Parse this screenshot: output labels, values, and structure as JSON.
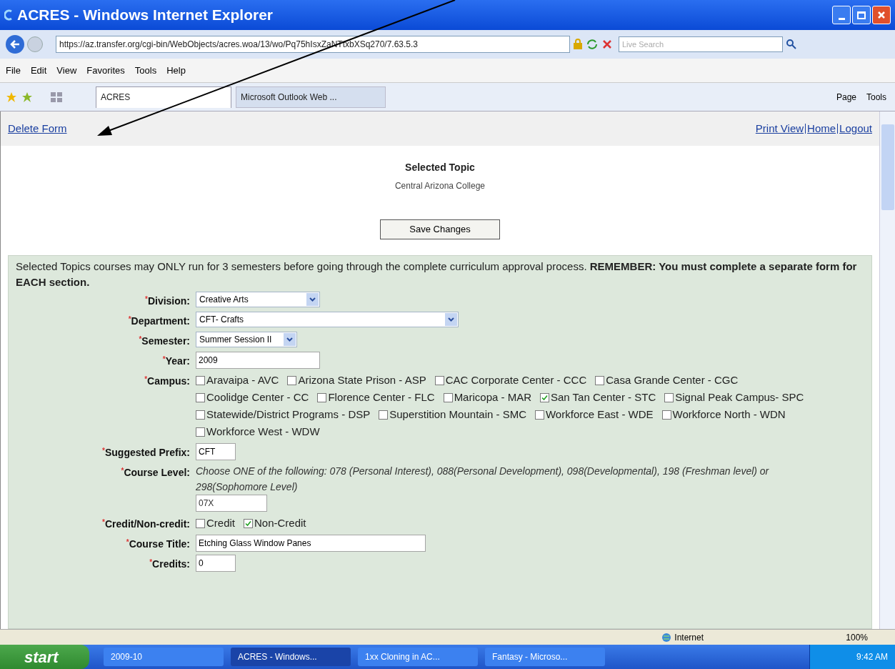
{
  "window": {
    "title": "ACRES - Windows Internet Explorer"
  },
  "address_bar": {
    "url": "https://az.transfer.org/cgi-bin/WebObjects/acres.woa/13/wo/Pq75hIsxZaNTtxbXSq270/7.63.5.3",
    "search_placeholder": "Live Search"
  },
  "menu": [
    "File",
    "Edit",
    "View",
    "Favorites",
    "Tools",
    "Help"
  ],
  "tabs": [
    {
      "label": "ACRES",
      "selected": true
    },
    {
      "label": "Microsoft Outlook Web ...",
      "selected": false
    }
  ],
  "toolbar": [
    "Page",
    "Tools"
  ],
  "page": {
    "left_links": [
      "Delete Form"
    ],
    "right_links": [
      "Print View",
      "Home",
      "Logout"
    ],
    "title": "Selected Topic",
    "subtitle": "Central Arizona College",
    "save_button": "Save Changes",
    "notice": "Selected Topics courses may ONLY run for 3 semesters before going through the complete curriculum approval process. **REMEMBER: You must complete a separate form for EACH section.**",
    "fields": [
      {
        "kind": "select",
        "marker": "*",
        "label": "Division:",
        "value": "Creative Arts"
      },
      {
        "kind": "select",
        "marker": "*",
        "label": "Department:",
        "value": "CFT- Crafts"
      },
      {
        "kind": "select",
        "marker": "*",
        "label": "Semester:",
        "value": "Summer Session II"
      },
      {
        "kind": "input",
        "marker": "*",
        "label": "Year:",
        "value": "2009"
      },
      {
        "kind": "checks",
        "marker": "*",
        "label": "Campus:",
        "options": [
          {
            "label": "Aravaipa - AVC",
            "checked": false
          },
          {
            "label": "Arizona State Prison - ASP",
            "checked": false
          },
          {
            "label": "CAC Corporate Center - CCC",
            "checked": false
          },
          {
            "label": "Casa Grande Center - CGC",
            "checked": false
          },
          {
            "label": "Coolidge Center - CC",
            "checked": false
          },
          {
            "label": "Florence Center - FLC",
            "checked": false
          },
          {
            "label": "Maricopa - MAR",
            "checked": false
          },
          {
            "label": "San Tan Center - STC",
            "checked": true
          },
          {
            "label": "Signal Peak Campus- SPC",
            "checked": false
          },
          {
            "label": "Statewide/District Programs - DSP",
            "checked": false
          },
          {
            "label": "Superstition Mountain - SMC",
            "checked": false
          },
          {
            "label": "Workforce East - WDE",
            "checked": false
          },
          {
            "label": "Workforce North - WDN",
            "checked": false
          },
          {
            "label": "Workforce West - WDW",
            "checked": false
          }
        ]
      },
      {
        "kind": "input",
        "marker": "*",
        "label": "Suggested Prefix:",
        "value": "CFT"
      },
      {
        "kind": "note_input",
        "marker": "*",
        "label": "Course Level:",
        "note": "Choose ONE of the following: 078 (Personal Interest), 088(Personal Development), 098(Developmental), 198 (Freshman level) or 298(Sophomore Level)",
        "value": "07X"
      },
      {
        "kind": "checks",
        "marker": "*",
        "label": "Credit/Non-credit:",
        "options": [
          {
            "label": "Credit",
            "checked": false
          },
          {
            "label": "Non-Credit",
            "checked": true
          }
        ]
      },
      {
        "kind": "input",
        "marker": "*",
        "label": "Course Title:",
        "value": "Etching Glass Window Panes"
      },
      {
        "kind": "input",
        "marker": "*",
        "label": "Credits:",
        "value": "0"
      }
    ]
  },
  "status_bar": {
    "zone": "Internet",
    "zoom": "100%"
  },
  "taskbar": {
    "start": "start",
    "items": [
      {
        "label": "2009-10",
        "selected": false
      },
      {
        "label": "ACRES - Windows...",
        "selected": true
      },
      {
        "label": "1xx Cloning in AC...",
        "selected": false
      },
      {
        "label": "Fantasy - Microso...",
        "selected": false
      }
    ],
    "clock": "9:42 AM"
  }
}
